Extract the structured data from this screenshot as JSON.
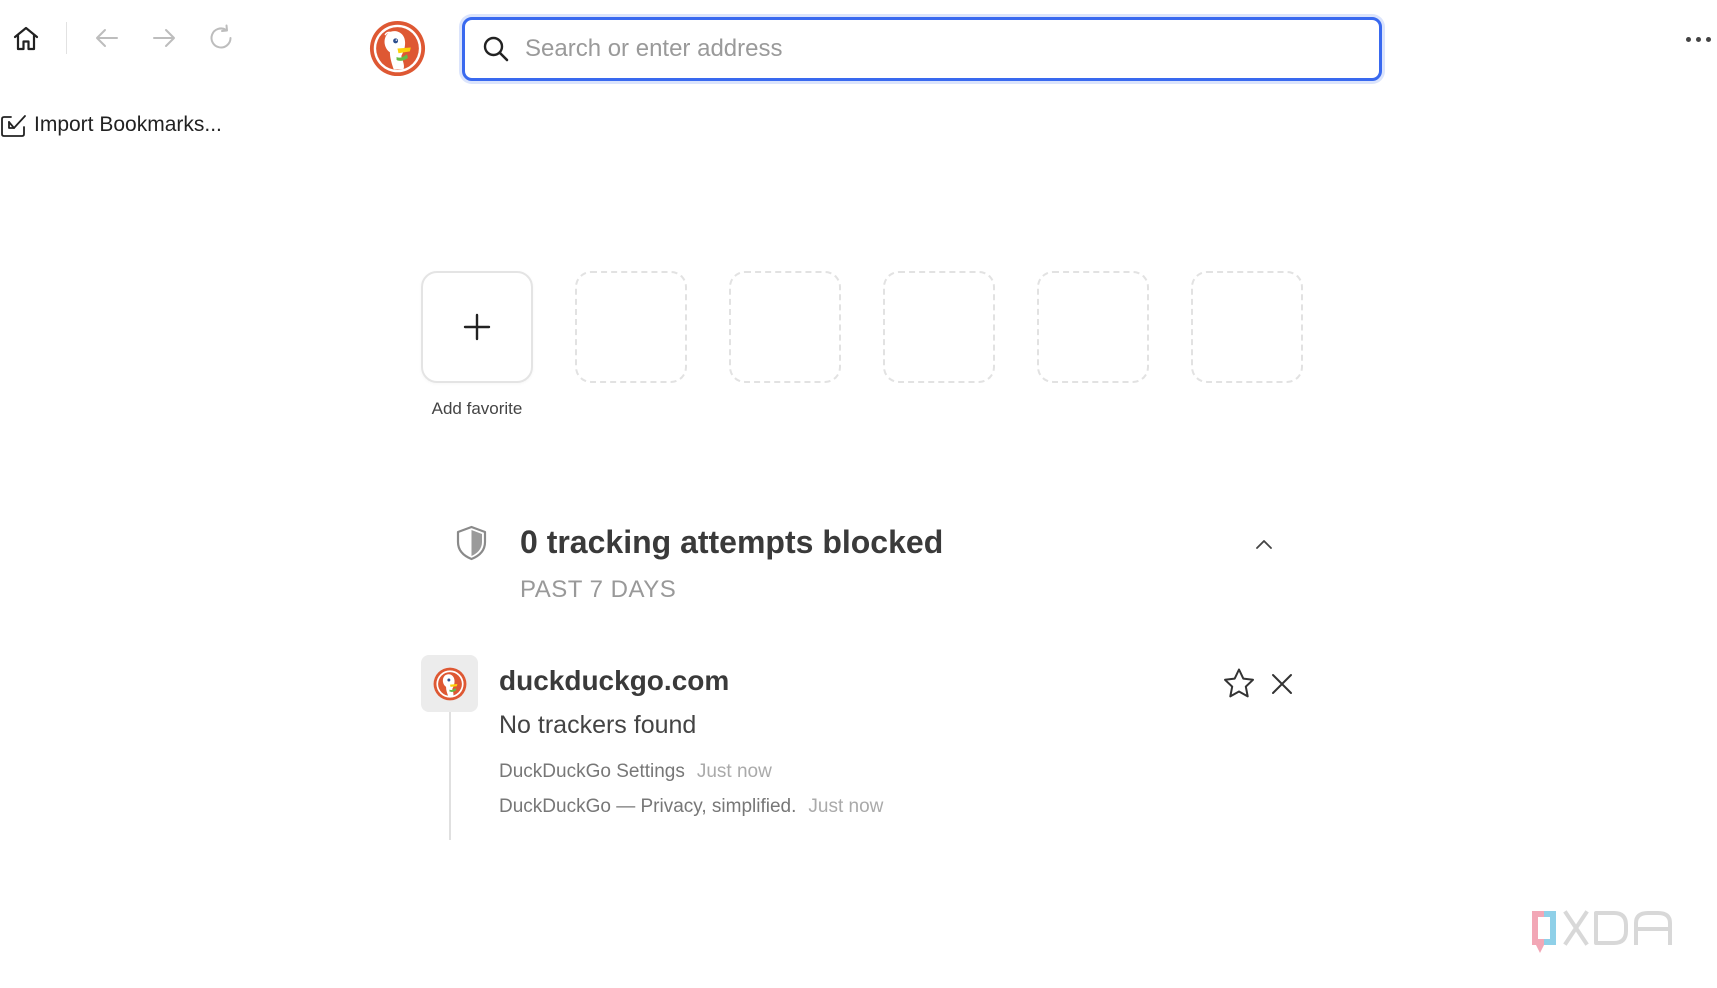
{
  "toolbar": {
    "icons": [
      "home-icon",
      "back-arrow-icon",
      "forward-arrow-icon",
      "reload-icon",
      "more-menu-icon"
    ],
    "search": {
      "placeholder": "Search or enter address",
      "value": ""
    },
    "accent_color": "#3969ef"
  },
  "bookmarks_bar": {
    "import_label": "Import Bookmarks..."
  },
  "favorites": {
    "add_label": "Add favorite",
    "empty_slots": 5
  },
  "privacy_stats": {
    "title": "0 tracking attempts blocked",
    "subtitle": "PAST 7 DAYS",
    "icon": "shield-icon"
  },
  "recent_activity": {
    "site": "duckduckgo.com",
    "status": "No trackers found",
    "items": [
      {
        "title": "DuckDuckGo Settings",
        "time": "Just now"
      },
      {
        "title": "DuckDuckGo — Privacy, simplified.",
        "time": "Just now"
      }
    ]
  },
  "brand": {
    "duck_orange": "#de5833",
    "duck_green": "#4caf50"
  }
}
